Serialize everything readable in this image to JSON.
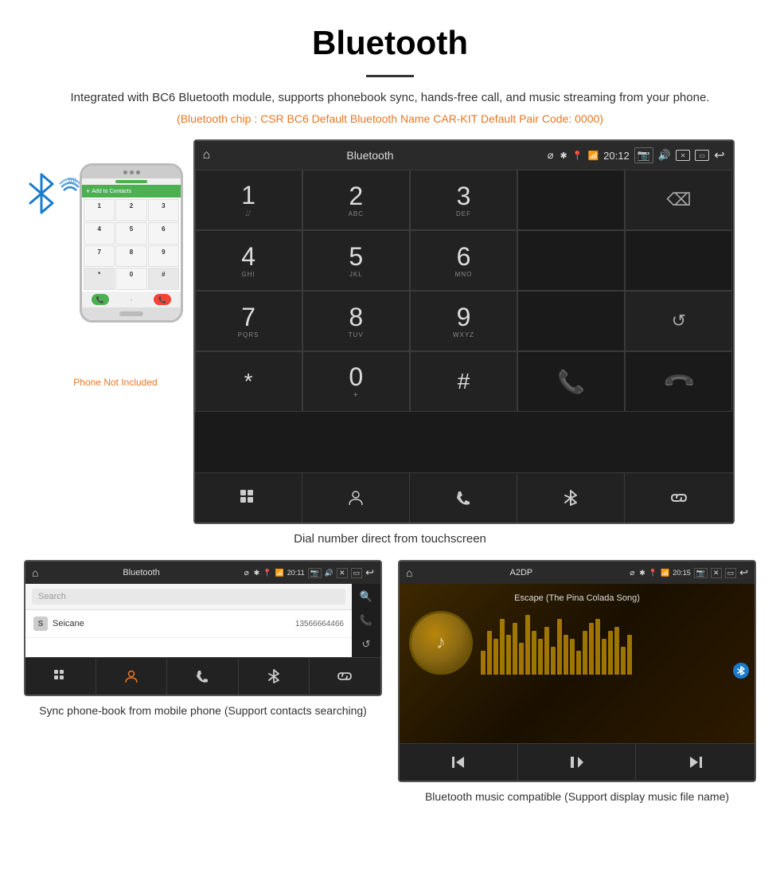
{
  "page": {
    "title": "Bluetooth",
    "description": "Integrated with BC6 Bluetooth module, supports phonebook sync, hands-free call, and music streaming from your phone.",
    "specs": "(Bluetooth chip : CSR BC6    Default Bluetooth Name CAR-KIT    Default Pair Code: 0000)",
    "main_caption": "Dial number direct from touchscreen",
    "bottom_left_caption": "Sync phone-book from mobile phone\n(Support contacts searching)",
    "bottom_right_caption": "Bluetooth music compatible\n(Support display music file name)",
    "phone_not_included": "Phone Not Included"
  },
  "car_screen_main": {
    "status_bar": {
      "title": "Bluetooth",
      "time": "20:12",
      "usb_icon": "⌀"
    },
    "dialpad": {
      "keys": [
        {
          "num": "1",
          "sub": ""
        },
        {
          "num": "2",
          "sub": "ABC"
        },
        {
          "num": "3",
          "sub": "DEF"
        },
        {
          "num": "",
          "sub": ""
        },
        {
          "num": "⌫",
          "sub": ""
        },
        {
          "num": "4",
          "sub": "GHI"
        },
        {
          "num": "5",
          "sub": "JKL"
        },
        {
          "num": "6",
          "sub": "MNO"
        },
        {
          "num": "",
          "sub": ""
        },
        {
          "num": "",
          "sub": ""
        },
        {
          "num": "7",
          "sub": "PQRS"
        },
        {
          "num": "8",
          "sub": "TUV"
        },
        {
          "num": "9",
          "sub": "WXYZ"
        },
        {
          "num": "",
          "sub": ""
        },
        {
          "num": "↺",
          "sub": ""
        },
        {
          "num": "*",
          "sub": ""
        },
        {
          "num": "0",
          "sub": "+"
        },
        {
          "num": "#",
          "sub": ""
        },
        {
          "num": "📞green",
          "sub": ""
        },
        {
          "num": "📞red",
          "sub": ""
        }
      ],
      "bottom_icons": [
        "⊞",
        "👤",
        "📞",
        "✱",
        "🔗"
      ]
    }
  },
  "phonebook_screen": {
    "status_bar": {
      "title": "Bluetooth",
      "time": "20:11"
    },
    "search_placeholder": "Search",
    "contacts": [
      {
        "letter": "S",
        "name": "Seicane",
        "number": "13566664466"
      }
    ],
    "bottom_icons": [
      "⊞",
      "👤",
      "📞",
      "✱",
      "🔗"
    ]
  },
  "music_screen": {
    "status_bar": {
      "title": "A2DP",
      "time": "20:15"
    },
    "song_title": "Escape (The Pina Colada Song)",
    "controls": [
      "⏮",
      "⏯",
      "⏭"
    ],
    "eq_bars": [
      30,
      55,
      45,
      70,
      50,
      65,
      40,
      75,
      55,
      45,
      60,
      35,
      70,
      50,
      45,
      30,
      55,
      65,
      70,
      45,
      55,
      60,
      35,
      50
    ]
  },
  "icons": {
    "home": "⌂",
    "bluetooth": "✱",
    "back": "↩",
    "settings": "⚙",
    "volume": "🔊",
    "camera": "📷",
    "search": "🔍",
    "phone": "📞",
    "refresh": "↺",
    "contact": "👤",
    "apps": "⊞",
    "link": "🔗",
    "prev": "⏮",
    "playpause": "⏯",
    "next": "⏭",
    "gps": "📍",
    "wifi": "📶"
  }
}
